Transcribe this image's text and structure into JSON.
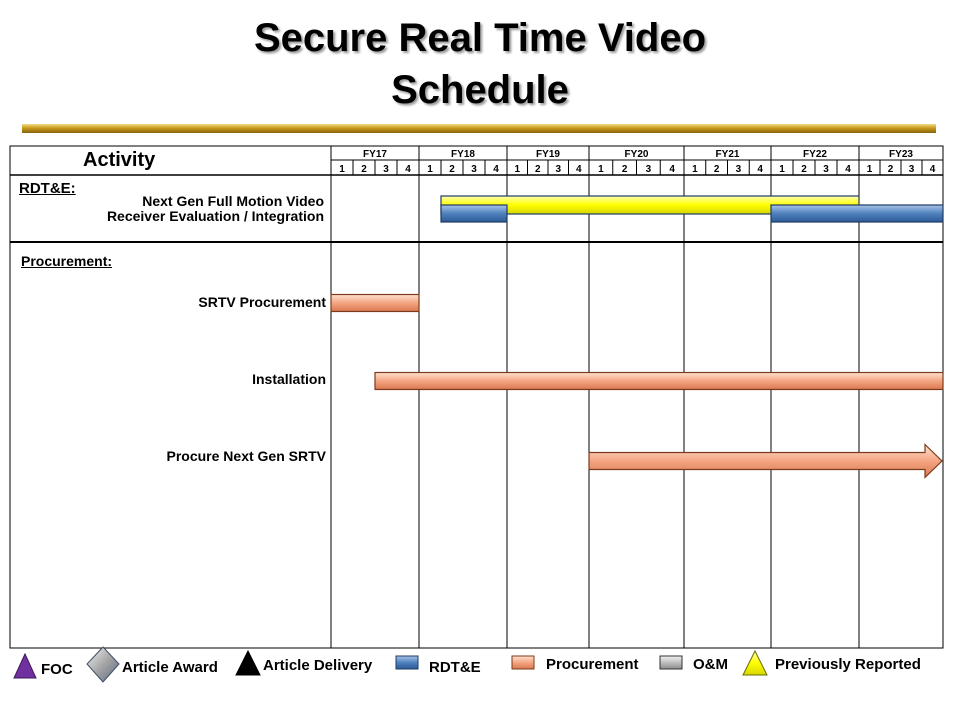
{
  "title_line1": "Secure Real Time Video",
  "title_line2": "Schedule",
  "activity_header": "Activity",
  "sections": {
    "rdte_label": "RDT&E:",
    "procurement_label": "Procurement:"
  },
  "activities": {
    "rdte_line1": "Next Gen Full Motion Video",
    "rdte_line2": "Receiver Evaluation / Integration",
    "srtv_procurement": "SRTV Procurement",
    "installation": "Installation",
    "procure_next_gen": "Procure Next Gen SRTV"
  },
  "legend": [
    {
      "label": "FOC",
      "icon": "purple-triangle-icon",
      "color": "#7030a0"
    },
    {
      "label": "Article Award",
      "icon": "silver-diamond-icon",
      "color": "#c0c0c0"
    },
    {
      "label": "Article Delivery",
      "icon": "black-triangle-icon",
      "color": "#000000"
    },
    {
      "label": "RDT&E",
      "icon": "blue-bar-icon",
      "color": "#4f81bd"
    },
    {
      "label": "Procurement",
      "icon": "orange-bar-icon",
      "color": "#f4a582"
    },
    {
      "label": "O&M",
      "icon": "gray-bar-icon",
      "color": "#bfbfbf"
    },
    {
      "label": "Previously Reported",
      "icon": "yellow-triangle-icon",
      "color": "#ffff00"
    }
  ],
  "chart_data": {
    "type": "gantt",
    "fiscal_years": [
      "FY17",
      "FY18",
      "FY19",
      "FY20",
      "FY21",
      "FY22",
      "FY23"
    ],
    "quarters": [
      "1",
      "2",
      "3",
      "4"
    ],
    "colors": {
      "rdte": "#4f81bd",
      "procurement": "#f4a582",
      "previously_reported": "#ffff00"
    },
    "bars": [
      {
        "activity": "Next Gen Full Motion Video Receiver Evaluation / Integration",
        "kind": "previously_reported",
        "start": "FY18 Q2",
        "end": "FY22 Q4"
      },
      {
        "activity": "Next Gen Full Motion Video Receiver Evaluation / Integration",
        "kind": "rdte",
        "start": "FY18 Q2",
        "end": "FY18 Q4"
      },
      {
        "activity": "Next Gen Full Motion Video Receiver Evaluation / Integration",
        "kind": "rdte",
        "start": "FY22 Q1",
        "end": "FY23 Q4"
      },
      {
        "activity": "SRTV Procurement",
        "kind": "procurement",
        "start": "FY17 Q1",
        "end": "FY17 Q4"
      },
      {
        "activity": "Installation",
        "kind": "procurement",
        "start": "FY17 Q3",
        "end": "FY23 Q4"
      },
      {
        "activity": "Procure Next Gen SRTV",
        "kind": "procurement",
        "start": "FY20 Q1",
        "end": "FY23 Q4",
        "continues": true
      }
    ]
  }
}
